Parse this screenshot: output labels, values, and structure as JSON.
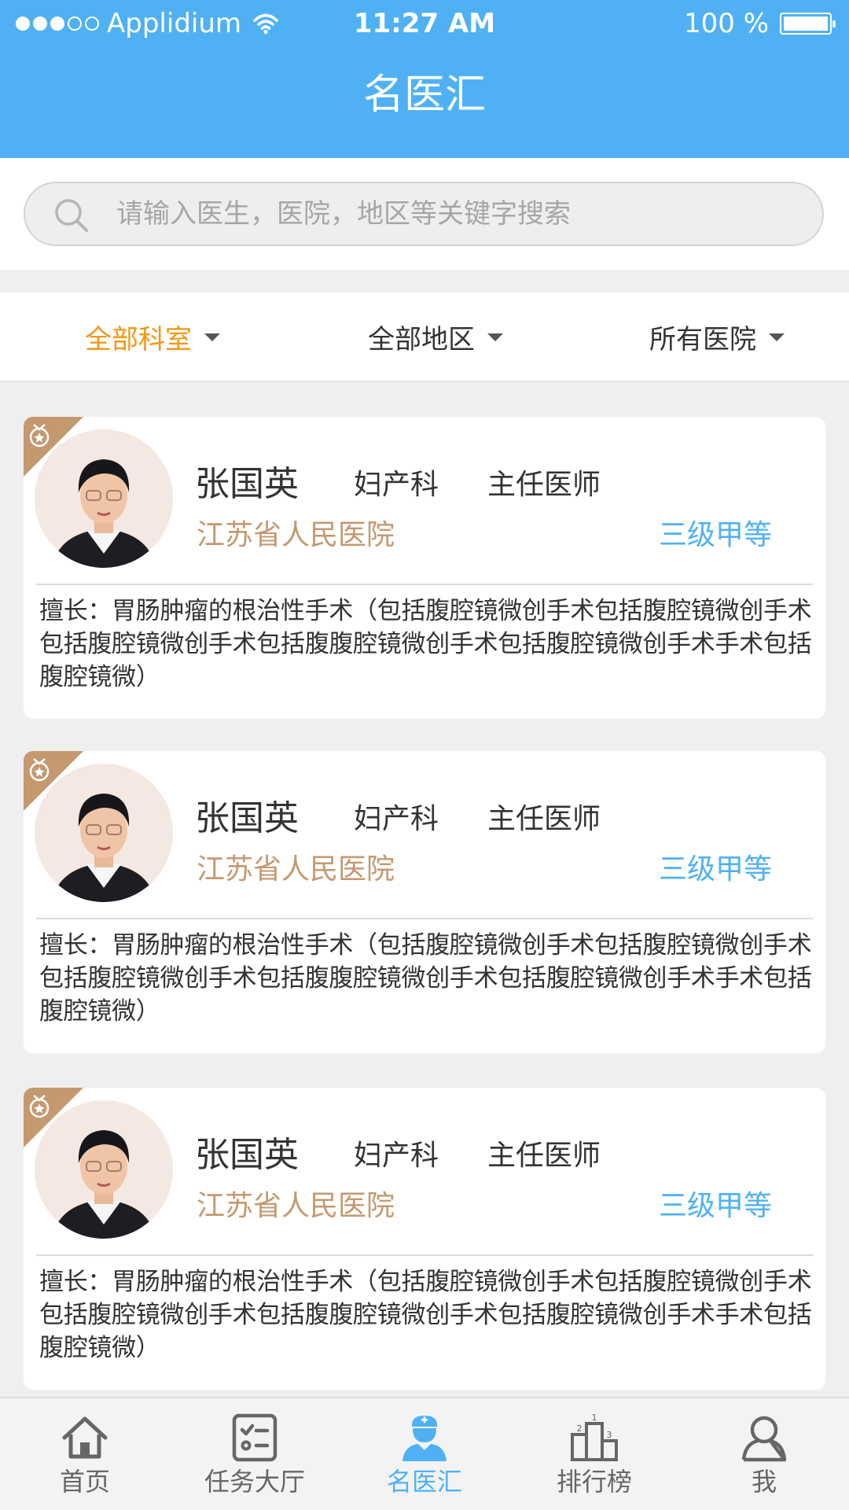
{
  "status_bar": {
    "carrier": "Applidium",
    "time": "11:27 AM",
    "battery": "100 %"
  },
  "nav": {
    "title": "名医汇"
  },
  "search": {
    "placeholder": "请输入医生，医院，地区等关键字搜索"
  },
  "filters": [
    {
      "label": "全部科室",
      "active": true
    },
    {
      "label": "全部地区",
      "active": false
    },
    {
      "label": "所有医院",
      "active": false
    }
  ],
  "doctors": [
    {
      "name": "张国英",
      "department": "妇产科",
      "title": "主任医师",
      "hospital": "江苏省人民医院",
      "level": "三级甲等",
      "expertise": "擅长：胃肠肿瘤的根治性手术（包括腹腔镜微创手术包括腹腔镜微创手术包括腹腔镜微创手术包括腹腹腔镜微创手术包括腹腔镜微创手术手术包括腹腔镜微）"
    },
    {
      "name": "张国英",
      "department": "妇产科",
      "title": "主任医师",
      "hospital": "江苏省人民医院",
      "level": "三级甲等",
      "expertise": "擅长：胃肠肿瘤的根治性手术（包括腹腔镜微创手术包括腹腔镜微创手术包括腹腔镜微创手术包括腹腹腔镜微创手术包括腹腔镜微创手术手术包括腹腔镜微）"
    },
    {
      "name": "张国英",
      "department": "妇产科",
      "title": "主任医师",
      "hospital": "江苏省人民医院",
      "level": "三级甲等",
      "expertise": "擅长：胃肠肿瘤的根治性手术（包括腹腔镜微创手术包括腹腔镜微创手术包括腹腔镜微创手术包括腹腹腔镜微创手术包括腹腔镜微创手术手术包括腹腔镜微）"
    }
  ],
  "tabs": [
    {
      "label": "首页",
      "icon": "home-icon",
      "active": false
    },
    {
      "label": "任务大厅",
      "icon": "task-list-icon",
      "active": false
    },
    {
      "label": "名医汇",
      "icon": "doctor-icon",
      "active": true
    },
    {
      "label": "排行榜",
      "icon": "ranking-podium-icon",
      "active": false
    },
    {
      "label": "我",
      "icon": "user-profile-icon",
      "active": false
    }
  ],
  "colors": {
    "header_blue": "#4fb1f4",
    "active_orange": "#f39613",
    "hospital_brown": "#c4996f",
    "level_blue": "#4fb1f4",
    "ribbon_gold": "#c4996f"
  }
}
